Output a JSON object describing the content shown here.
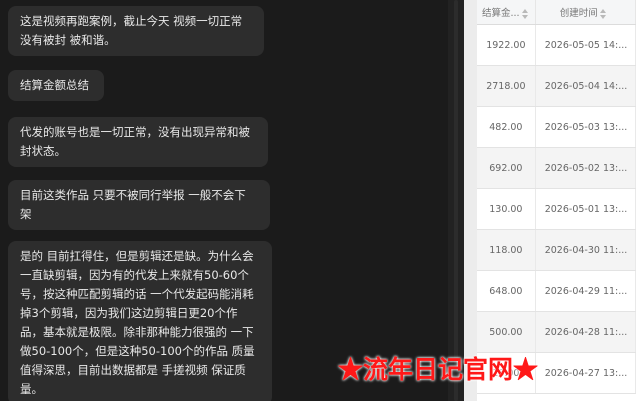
{
  "chat": {
    "messages": [
      {
        "lines": [
          "这是视频再跑案例，截止今天 视频一切正常",
          "没有被封 被和谐。"
        ]
      },
      {
        "lines": [
          "结算金额总结"
        ]
      },
      {
        "lines": [
          "代发的账号也是一切正常，没有出现异常和被",
          "封状态。"
        ]
      },
      {
        "lines": [
          "目前这类作品 只要不被同行举报  一般不会下",
          "架"
        ]
      },
      {
        "lines": [
          "是的 目前扛得住，但是剪辑还是缺。为什么会",
          "一直缺剪辑，因为有的代发上来就有50-60个",
          "号，按这种匹配剪辑的话 一个代发起码能消耗",
          "掉3个剪辑，因为我们这边剪辑日更20个作",
          "品，基本就是极限。除非那种能力很强的 一下",
          "做50-100个，但是这种50-100个的作品 质量",
          "值得深思，目前出数据都是 手搓视频 保证质",
          "量。"
        ]
      }
    ]
  },
  "table": {
    "columns": [
      {
        "label": "结算金..."
      },
      {
        "label": "创建时间"
      }
    ],
    "rows": [
      {
        "amount": "1922.00",
        "created": "2026-05-05 14:..."
      },
      {
        "amount": "2718.00",
        "created": "2026-05-04 14:..."
      },
      {
        "amount": "482.00",
        "created": "2026-05-03 13:..."
      },
      {
        "amount": "692.00",
        "created": "2026-05-02 13:..."
      },
      {
        "amount": "130.00",
        "created": "2026-05-01 13:..."
      },
      {
        "amount": "118.00",
        "created": "2026-04-30 11:..."
      },
      {
        "amount": "648.00",
        "created": "2026-04-29 11:..."
      },
      {
        "amount": "500.00",
        "created": "2026-04-28 11:..."
      },
      {
        "amount": "16.00",
        "created": "2026-04-27 13:..."
      }
    ]
  },
  "watermark": "★流年日记官网★",
  "colors": {
    "watermark": "#ff1818",
    "bubble": "#2d2d2d",
    "chat_bg": "#1b1b1b"
  }
}
